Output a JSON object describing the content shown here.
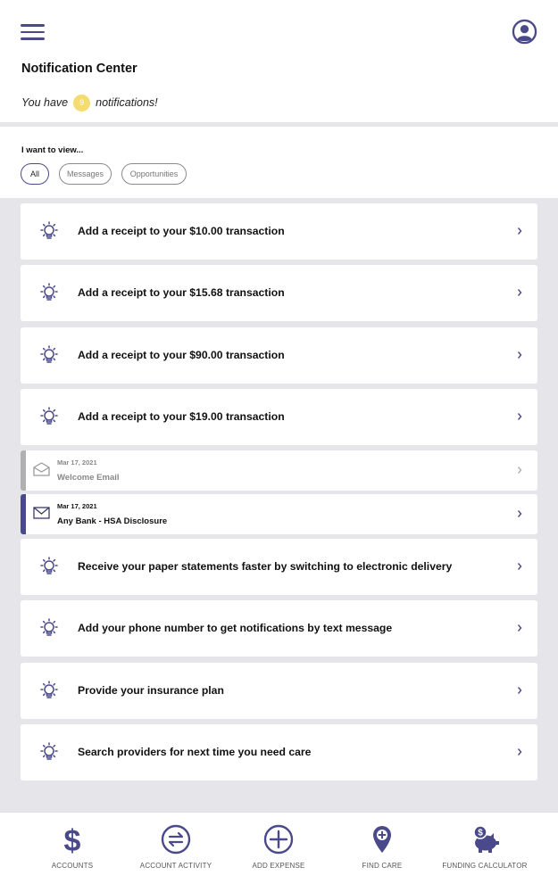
{
  "header": {
    "title": "Notification Center",
    "count_prefix": "You have",
    "count": "9",
    "count_suffix": "notifications!"
  },
  "filter": {
    "label": "I want to view...",
    "chips": [
      {
        "label": "All",
        "active": true
      },
      {
        "label": "Messages",
        "active": false
      },
      {
        "label": "Opportunities",
        "active": false
      }
    ]
  },
  "notifications": [
    {
      "type": "opportunity",
      "icon": "lightbulb-icon",
      "text": "Add a receipt to your $10.00 transaction"
    },
    {
      "type": "opportunity",
      "icon": "lightbulb-icon",
      "text": "Add a receipt to your $15.68 transaction"
    },
    {
      "type": "opportunity",
      "icon": "lightbulb-icon",
      "text": "Add a receipt to your $90.00 transaction"
    },
    {
      "type": "opportunity",
      "icon": "lightbulb-icon",
      "text": "Add a receipt to your $19.00 transaction"
    },
    {
      "type": "message",
      "icon": "envelope-open-icon",
      "date": "Mar 17, 2021",
      "subject": "Welcome Email",
      "read": true
    },
    {
      "type": "message",
      "icon": "envelope-icon",
      "date": "Mar 17, 2021",
      "subject": "Any Bank - HSA Disclosure",
      "read": false
    },
    {
      "type": "opportunity",
      "icon": "lightbulb-icon",
      "text": "Receive your paper statements faster by switching to electronic delivery"
    },
    {
      "type": "opportunity",
      "icon": "lightbulb-icon",
      "text": "Add your phone number to get notifications by text message"
    },
    {
      "type": "opportunity",
      "icon": "lightbulb-icon",
      "text": "Provide your insurance plan"
    },
    {
      "type": "opportunity",
      "icon": "lightbulb-icon",
      "text": "Search providers for next time you need care"
    }
  ],
  "footer_nav": [
    {
      "label": "ACCOUNTS",
      "icon": "dollar-icon"
    },
    {
      "label": "ACCOUNT ACTIVITY",
      "icon": "transfer-arrows-icon"
    },
    {
      "label": "ADD EXPENSE",
      "icon": "plus-circle-icon"
    },
    {
      "label": "FIND CARE",
      "icon": "map-pin-plus-icon"
    },
    {
      "label": "FUNDING CALCULATOR",
      "icon": "piggy-bank-icon"
    }
  ],
  "colors": {
    "accent": "#4a4a8a",
    "badge": "#f5dc70",
    "background": "#e6e5ea",
    "read_bar": "#b0b0b0"
  }
}
